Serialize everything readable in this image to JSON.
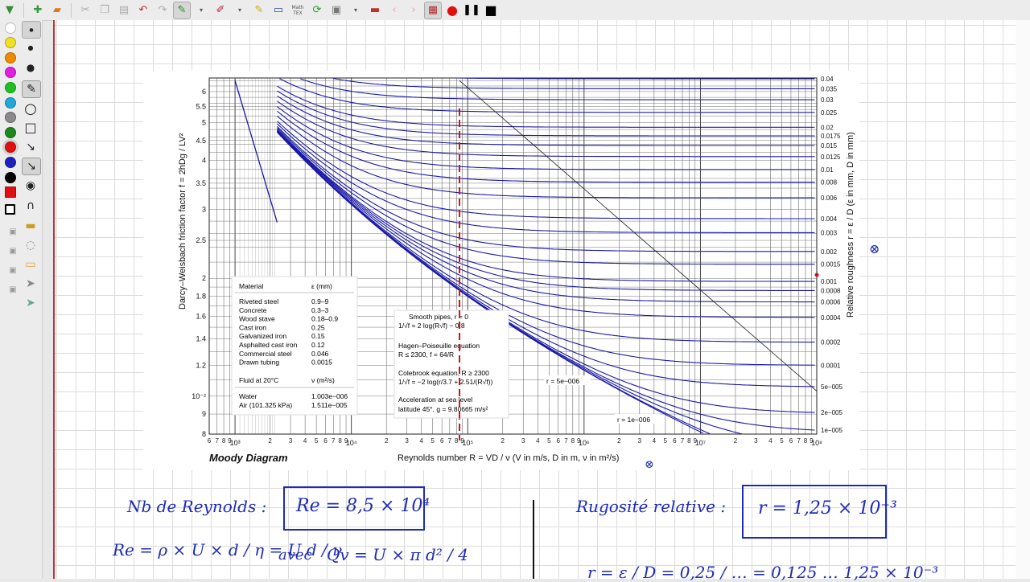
{
  "colors": {
    "ink": "#1e2bb8",
    "curve": "#1a1aa8",
    "dashed": "#d01010",
    "margin": "#c9302c"
  },
  "toolbar": {
    "icons": [
      "save-icon",
      "new-page-icon",
      "open-icon",
      "cut-icon",
      "copy-icon",
      "paste-icon",
      "undo-icon",
      "redo-icon",
      "pen-icon",
      "eraser-icon",
      "highlighter-icon",
      "screen-icon",
      "math-tex-icon",
      "refresh-icon",
      "insert-page-icon",
      "delete-page-icon",
      "prev-page-icon",
      "next-page-icon",
      "record-screen-icon",
      "record-icon",
      "pause-icon",
      "stop-icon"
    ],
    "mathtex_label": "Math\nTEX"
  },
  "sidebar": {
    "colors": [
      "#ffffff",
      "#f0e020",
      "#f08a00",
      "#e020e0",
      "#20c020",
      "#20a8d8",
      "#8a8a8a",
      "#1a8a1a",
      "#e01010",
      "#2020c0",
      "#000000"
    ],
    "tools": [
      "small-dot-icon",
      "medium-dot-icon",
      "large-dot-icon",
      "pencil-tool-icon",
      "circle-tool-icon",
      "rectangle-tool-icon",
      "line-tool-icon",
      "arrow-tool-icon",
      "fill-tool-icon",
      "magnet-icon"
    ]
  },
  "chart": {
    "title": "Moody Diagram",
    "xlabel": "Reynolds number  R = VD / ν  (V in m/s, D in m, ν in m²/s)",
    "ylabel": "Darcy–Weisbach friction factor  f = 2hDg / LV²",
    "rlabel": "Relative roughness  r = ε / D  (ε in mm, D in mm)",
    "yticks": [
      "6",
      "5.5",
      "5",
      "4.5",
      "4",
      "3.5",
      "3",
      "2.5",
      "2",
      "1.8",
      "1.6",
      "1.4",
      "1.2",
      "10⁻²",
      "9",
      "8"
    ],
    "xdecades": [
      "10³",
      "10⁴",
      "10⁵",
      "10⁶",
      "10⁷",
      "10⁸"
    ],
    "rticks": [
      "0.04",
      "0.035",
      "0.03",
      "0.025",
      "0.02",
      "0.0175",
      "0.015",
      "0.0125",
      "0.01",
      "0.008",
      "0.006",
      "0.004",
      "0.003",
      "0.002",
      "0.0015",
      "0.001",
      "0.0008",
      "0.0006",
      "0.0004",
      "0.0002",
      "0.0001",
      "5e−005",
      "2e−005",
      "1e−005"
    ],
    "material_table": {
      "h1": "Material",
      "h2": "ε (mm)",
      "rows": [
        [
          "Riveted steel",
          "0.9–9"
        ],
        [
          "Concrete",
          "0.3–3"
        ],
        [
          "Wood stave",
          "0.18–0.9"
        ],
        [
          "Cast iron",
          "0.25"
        ],
        [
          "Galvanized iron",
          "0.15"
        ],
        [
          "Asphalted cast iron",
          "0.12"
        ],
        [
          "Commercial steel",
          "0.046"
        ],
        [
          "Drawn tubing",
          "0.0015"
        ]
      ]
    },
    "fluid_table": {
      "h1": "Fluid at 20°C",
      "h2": "ν (m²/s)",
      "rows": [
        [
          "Water",
          "1.003e−006"
        ],
        [
          "Air (101.325 kPa)",
          "1.511e−005"
        ]
      ]
    },
    "notes": [
      "Smooth pipes, r = 0",
      "1/√f = 2 log(R√f) − 0.8",
      "Hagen–Poiseuille equation",
      "R ≤ 2300,  f = 64/R",
      "Colebrook equation, R ≥ 2300",
      "1/√f = −2 log(r/3.7 + 2.51/(R√f))",
      "Acceleration at sea level",
      "latitude 45°,  g = 9.80665 m/s²"
    ],
    "curve_labels": [
      "r = 5e−006",
      "r = 1e−006"
    ]
  },
  "chart_data": {
    "type": "line",
    "title": "Moody Diagram",
    "xlabel": "Reynolds number  R = VD / ν  (V in m/s, D in m, ν in m²/s)",
    "ylabel": "Darcy–Weisbach friction factor  f = 2hDg / LV²",
    "x_scale": "log",
    "y_scale": "log",
    "xlim": [
      600,
      100000000
    ],
    "ylim": [
      0.008,
      0.065
    ],
    "relative_roughness": [
      0.04,
      0.035,
      0.03,
      0.025,
      0.02,
      0.0175,
      0.015,
      0.0125,
      0.01,
      0.008,
      0.006,
      0.004,
      0.003,
      0.002,
      0.0015,
      0.001,
      0.0008,
      0.0006,
      0.0004,
      0.0002,
      0.0001,
      5e-05,
      2e-05,
      1e-05,
      5e-06,
      1e-06,
      0
    ],
    "laminar": {
      "x": [
        1000,
        2300
      ],
      "y": [
        0.064,
        0.0278
      ]
    },
    "marker_reynolds": 85000
  },
  "notes": {
    "reynolds_label": "Nb de Reynolds :",
    "reynolds_value": "Re = 8,5 × 10⁴",
    "rugosite_label": "Rugosité relative :",
    "rugosite_value": "r = 1,25 × 10⁻³",
    "formula": "Re = ρ × U × d / η = U d / ν",
    "avec": "avec",
    "qv": "Qv = U × π d² / 4",
    "bottom_right": "r = ε / D = 0,25 / … = 0,125 … 1,25 × 10⁻³",
    "mark_x": "⊗"
  }
}
